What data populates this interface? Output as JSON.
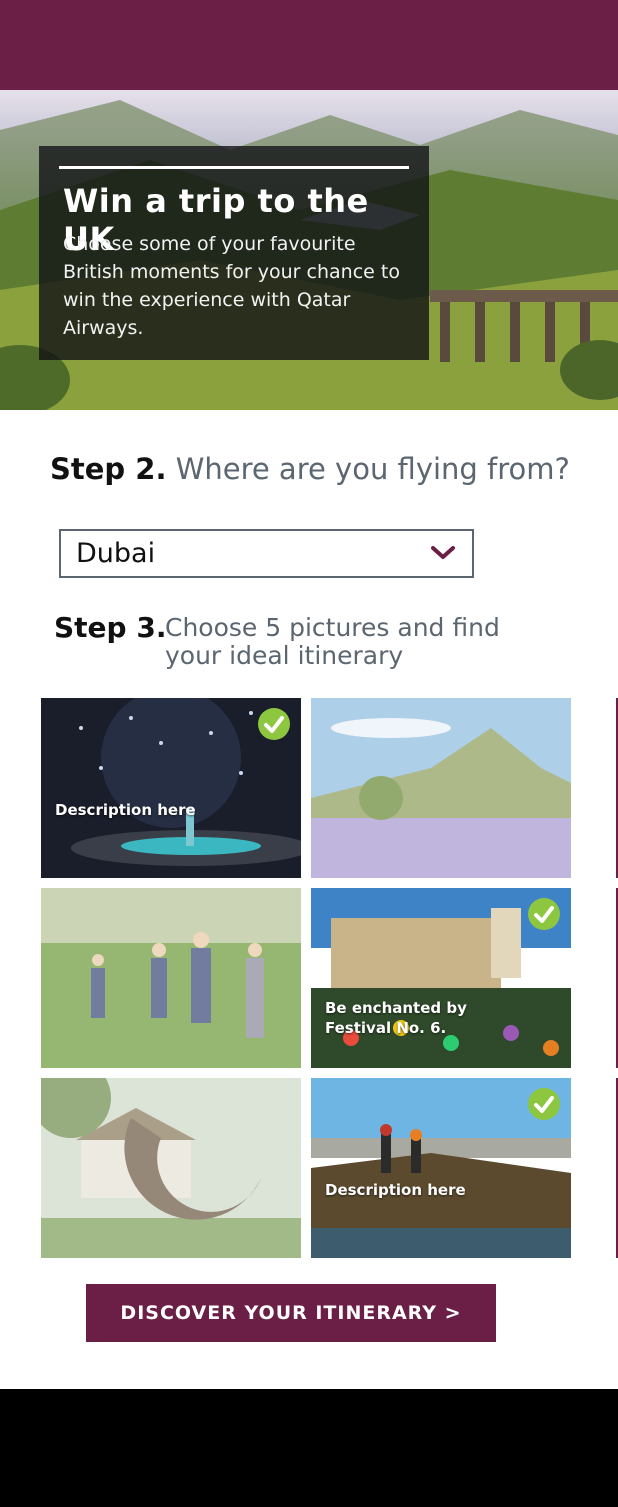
{
  "hero": {
    "title": "Win a trip to the UK",
    "text": "Choose some of your favourite British moments for your chance to win the experience with Qatar Airways."
  },
  "step2": {
    "label": "Step 2.",
    "question": "Where are you flying from?",
    "selected_city": "Dubai"
  },
  "step3": {
    "label": "Step 3.",
    "instruction": "Choose 5 pictures and find your ideal itinerary"
  },
  "tiles": [
    {
      "caption": "Description here",
      "selected": true
    },
    {
      "caption": "",
      "selected": false
    },
    {
      "caption": "",
      "selected": false
    },
    {
      "caption": "Be enchanted by Festival No. 6.",
      "selected": true
    },
    {
      "caption": "",
      "selected": false
    },
    {
      "caption": "Description here",
      "selected": true
    }
  ],
  "cta": {
    "label": "DISCOVER YOUR ITINERARY >"
  },
  "colors": {
    "brand": "#6b1f47",
    "check": "#8dc63f",
    "text_grey": "#5b6670"
  },
  "icons": {
    "dropdown": "chevron-down-icon",
    "selected": "checkmark-icon"
  }
}
